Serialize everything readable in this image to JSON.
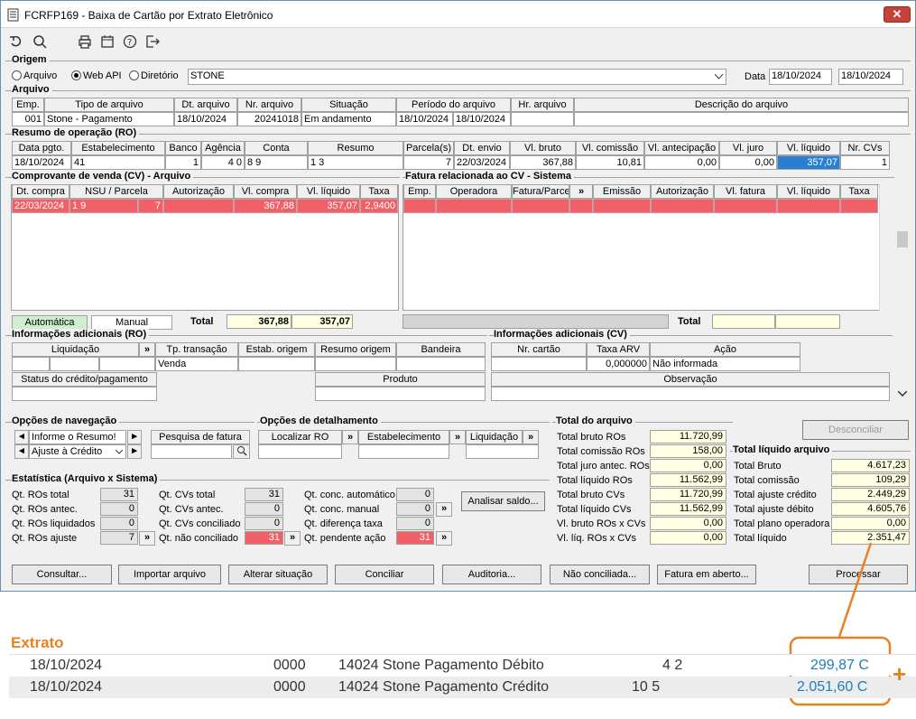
{
  "window": {
    "title": "FCRFP169 - Baixa de Cartão por Extrato Eletrônico",
    "close": "✕"
  },
  "origem": {
    "label": "Origem",
    "opt1": "Arquivo",
    "opt2": "Web API",
    "opt3": "Diretório",
    "selected": "Web API",
    "value": "STONE",
    "data_label": "Data",
    "date1": "18/10/2024",
    "date2": "18/10/2024"
  },
  "arquivo": {
    "label": "Arquivo",
    "headers": [
      "Emp.",
      "Tipo de arquivo",
      "Dt. arquivo",
      "Nr. arquivo",
      "Situação",
      "Período do arquivo",
      "Hr. arquivo",
      "Descrição do arquivo"
    ],
    "row": [
      "001",
      "Stone - Pagamento",
      "18/10/2024",
      "20241018",
      "Em andamento",
      "18/10/2024",
      "18/10/2024",
      "",
      ""
    ]
  },
  "ro": {
    "label": "Resumo de operação (RO)",
    "headers": [
      "Data pgto.",
      "Estabelecimento",
      "Banco",
      "Agência",
      "Conta",
      "Resumo",
      "Parcela(s)",
      "Dt. envio",
      "Vl. bruto",
      "Vl. comissão",
      "Vl. antecipação",
      "Vl. juro",
      "Vl. líquido",
      "Nr. CVs"
    ],
    "row": [
      "18/10/2024",
      "41",
      "1",
      "4  0",
      "8  9",
      "1  3",
      "7",
      "22/03/2024",
      "367,88",
      "10,81",
      "0,00",
      "0,00",
      "357,07",
      "1"
    ]
  },
  "cv": {
    "label": "Comprovante de venda (CV) - Arquivo",
    "headers": [
      "Dt. compra",
      "NSU / Parcela",
      "Autorização",
      "Vl. compra",
      "Vl. líquido",
      "Taxa"
    ],
    "row": [
      "22/03/2024",
      "1  9",
      "7",
      "",
      "367,88",
      "357,07",
      "2,9400"
    ],
    "auto": "Automática",
    "manual": "Manual",
    "total_label": "Total",
    "total_compra": "367,88",
    "total_liquido": "357,07"
  },
  "fatura": {
    "label": "Fatura relacionada ao CV - Sistema",
    "headers": [
      "Emp.",
      "Operadora",
      "Fatura/Parcela",
      "»",
      "Emissão",
      "Autorização",
      "Vl. fatura",
      "Vl. líquido",
      "Taxa"
    ],
    "total_label": "Total"
  },
  "info_ro": {
    "label": "Informações adicionais (RO)",
    "headers": [
      "Liquidação",
      "»",
      "Tp. transação",
      "Estab. origem",
      "Resumo origem",
      "Bandeira"
    ],
    "tp": "Venda",
    "status_label": "Status do crédito/pagamento",
    "produto_label": "Produto"
  },
  "info_cv": {
    "label": "Informações adicionais (CV)",
    "headers": [
      "Nr. cartão",
      "Taxa ARV",
      "Ação"
    ],
    "taxa": "0,000000",
    "acao": "Não informada",
    "obs_label": "Observação"
  },
  "nav": {
    "label": "Opções de navegação",
    "item1": "Informe o Resumo!",
    "item2": "Ajuste à Crédito",
    "pesquisa": "Pesquisa de fatura"
  },
  "det": {
    "label": "Opções de detalhamento",
    "localizar": "Localizar RO",
    "estab": "Estabelecimento",
    "liquidacao": "Liquidação"
  },
  "total_arquivo": {
    "label": "Total do arquivo",
    "rows": [
      [
        "Total bruto ROs",
        "11.720,99"
      ],
      [
        "Total comissão ROs",
        "158,00"
      ],
      [
        "Total juro antec. ROs",
        "0,00"
      ],
      [
        "Total líquido ROs",
        "11.562,99"
      ],
      [
        "Total bruto CVs",
        "11.720,99"
      ],
      [
        "Total líquido CVs",
        "11.562,99"
      ],
      [
        "Vl. bruto ROs x CVs",
        "0,00"
      ],
      [
        "Vl. líq. ROs x CVs",
        "0,00"
      ]
    ]
  },
  "total_liquido": {
    "label": "Total líquido arquivo",
    "rows": [
      [
        "Total Bruto",
        "4.617,23"
      ],
      [
        "Total comissão",
        "109,29"
      ],
      [
        "Total ajuste crédito",
        "2.449,29"
      ],
      [
        "Total ajuste débito",
        "4.605,76"
      ],
      [
        "Total plano operadora",
        "0,00"
      ],
      [
        "Total líquido",
        "2.351,47"
      ]
    ],
    "desconciliar": "Desconciliar"
  },
  "estat": {
    "label": "Estatística (Arquivo x Sistema)",
    "c1": [
      [
        "Qt. ROs total",
        "31"
      ],
      [
        "Qt. ROs antec.",
        "0"
      ],
      [
        "Qt. ROs liquidados",
        "0"
      ],
      [
        "Qt. ROs ajuste",
        "7"
      ]
    ],
    "c2": [
      [
        "Qt. CVs total",
        "31"
      ],
      [
        "Qt. CVs antec.",
        "0"
      ],
      [
        "Qt. CVs conciliado",
        "0"
      ],
      [
        "Qt. não conciliado",
        "31"
      ]
    ],
    "c3": [
      [
        "Qt. conc. automático",
        "0"
      ],
      [
        "Qt. conc. manual",
        "0"
      ],
      [
        "Qt. diferença taxa",
        "0"
      ],
      [
        "Qt. pendente ação",
        "31"
      ]
    ],
    "analisar": "Analisar saldo..."
  },
  "buttons": [
    "Consultar...",
    "Importar arquivo",
    "Alterar situação",
    "Conciliar",
    "Auditoria...",
    "Não conciliada...",
    "Fatura em aberto...",
    "Processar"
  ],
  "extrato": {
    "title": "Extrato",
    "rows": [
      {
        "date": "18/10/2024",
        "code": "0000",
        "desc": "14024 Stone Pagamento Débito",
        "doc": "4                2",
        "value": "299,87 C"
      },
      {
        "date": "18/10/2024",
        "code": "0000",
        "desc": "14024 Stone Pagamento Crédito",
        "doc": "10                5",
        "value": "2.051,60 C"
      }
    ],
    "plus": "+"
  },
  "colors": {
    "accent": "#e8821e",
    "highlight": "#f06066",
    "value_blue": "#1a7fc1"
  }
}
